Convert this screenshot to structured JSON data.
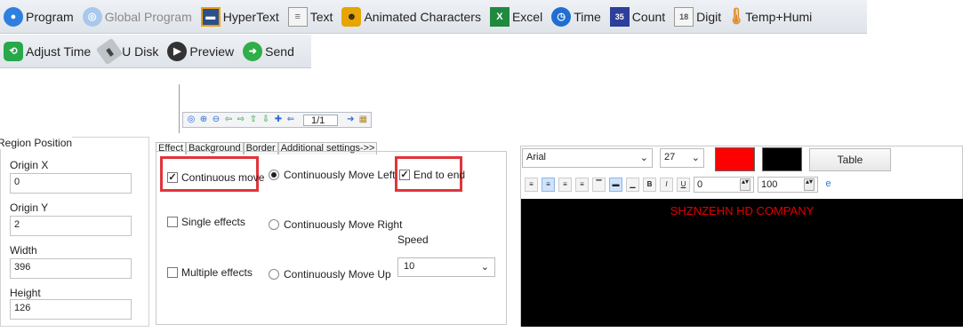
{
  "toolbar1": [
    {
      "label": "Program",
      "icon": "program-icon",
      "enabled": true
    },
    {
      "label": "Global Program",
      "icon": "globe-icon",
      "enabled": false
    },
    {
      "label": "HyperText",
      "icon": "hypertext-icon",
      "enabled": true
    },
    {
      "label": "Text",
      "icon": "text-icon",
      "enabled": true
    },
    {
      "label": "Animated Characters",
      "icon": "animated-characters-icon",
      "enabled": true
    },
    {
      "label": "Excel",
      "icon": "excel-icon",
      "enabled": true
    },
    {
      "label": "Time",
      "icon": "clock-icon",
      "enabled": true
    },
    {
      "label": "Count",
      "icon": "count-icon",
      "enabled": true
    },
    {
      "label": "Digit",
      "icon": "digit-icon",
      "enabled": true
    },
    {
      "label": "Temp+Humi",
      "icon": "thermometer-icon",
      "enabled": true
    }
  ],
  "toolbar2": [
    {
      "label": "Adjust Time",
      "icon": "adjust-time-icon"
    },
    {
      "label": "U Disk",
      "icon": "usb-disk-icon"
    },
    {
      "label": "Preview",
      "icon": "play-icon"
    },
    {
      "label": "Send",
      "icon": "send-arrow-icon"
    }
  ],
  "nav": {
    "page": "1/1"
  },
  "region": {
    "title": "Region Position",
    "origin_x_label": "Origin X",
    "origin_x": "0",
    "origin_y_label": "Origin Y",
    "origin_y": "2",
    "width_label": "Width",
    "width": "396",
    "height_label": "Height",
    "height": "126"
  },
  "tabs": [
    "Effect",
    "Background",
    "Border",
    "Additional settings->>"
  ],
  "effect": {
    "continuous_move": "Continuous move",
    "single_effects": "Single effects",
    "multiple_effects": "Multiple effects",
    "move_left": "Continuously Move Left",
    "move_right": "Continuously Move Right",
    "move_up": "Continuously Move Up",
    "end_to_end": "End to end",
    "speed_label": "Speed",
    "speed_value": "10"
  },
  "editor": {
    "font": "Arial",
    "size": "27",
    "fg_color": "#ff0000",
    "bg_color": "#000000",
    "table_button": "Table",
    "spacing_value": "0",
    "scale_value": "100",
    "preview_text": "SHZNZEHN HD COMPANY"
  }
}
